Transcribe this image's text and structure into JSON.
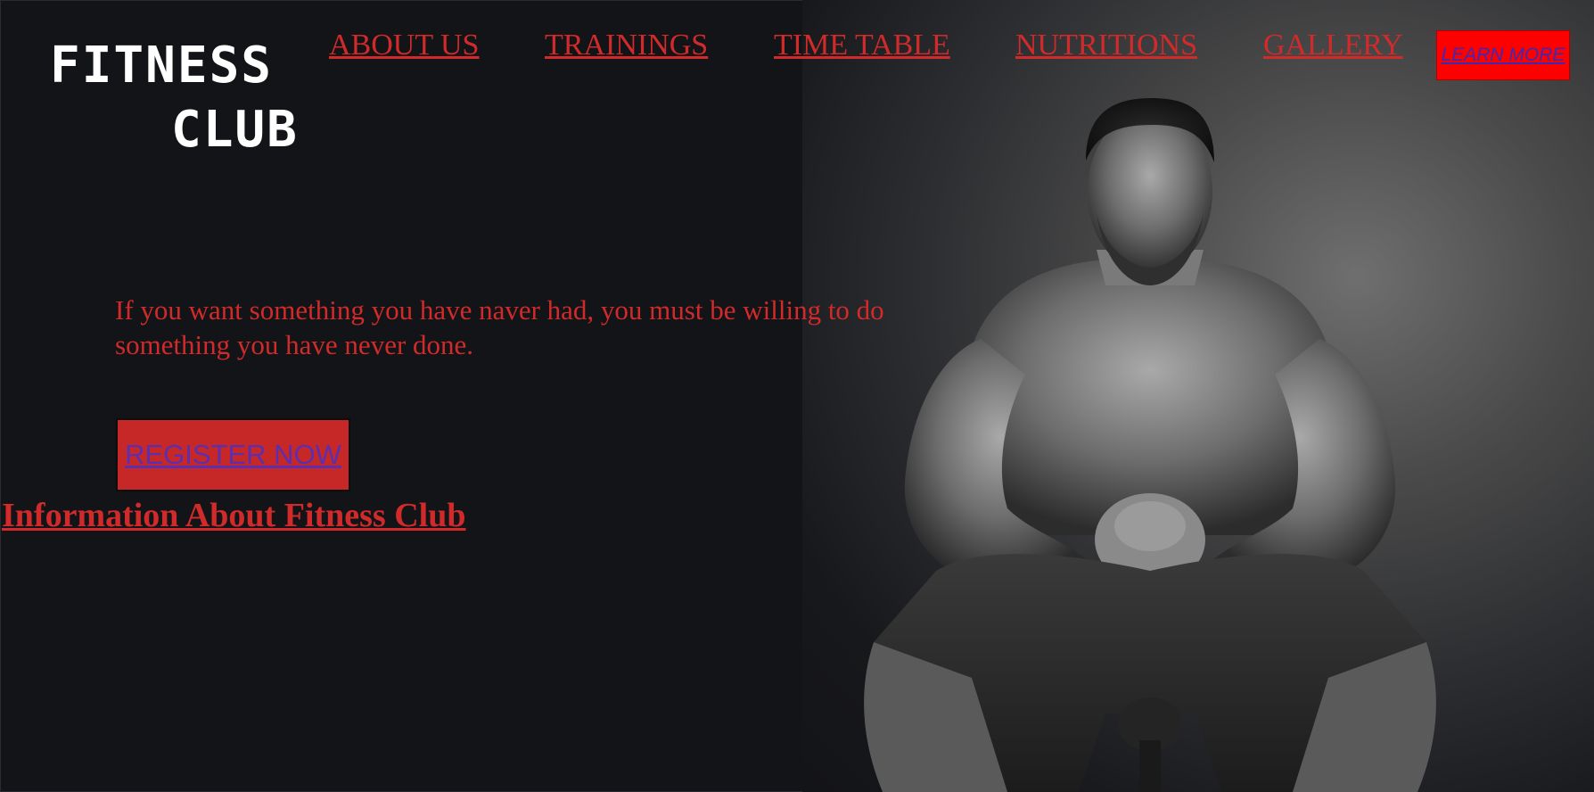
{
  "brand": {
    "line1": "FITNESS",
    "line2": "CLUB"
  },
  "nav": {
    "items": [
      {
        "label": "ABOUT US"
      },
      {
        "label": "TRAININGS"
      },
      {
        "label": "TIME TABLE"
      },
      {
        "label": "NUTRITIONS"
      },
      {
        "label": "GALLERY"
      }
    ],
    "learn_more_label": "LEARN MORE"
  },
  "hero": {
    "quote": "If you want something you have naver had, you must be willing to do something you have never done.",
    "register_label": "REGISTER NOW",
    "info_heading": "Information About Fitness Club",
    "photo_description_icon": "athlete-photo"
  },
  "colors": {
    "background": "#131417",
    "accent_red": "#d12a2a",
    "learn_more_bg": "#ff0000",
    "register_bg": "#c62828",
    "link_purple": "#5b2fb0",
    "logo_text": "#ffffff"
  }
}
